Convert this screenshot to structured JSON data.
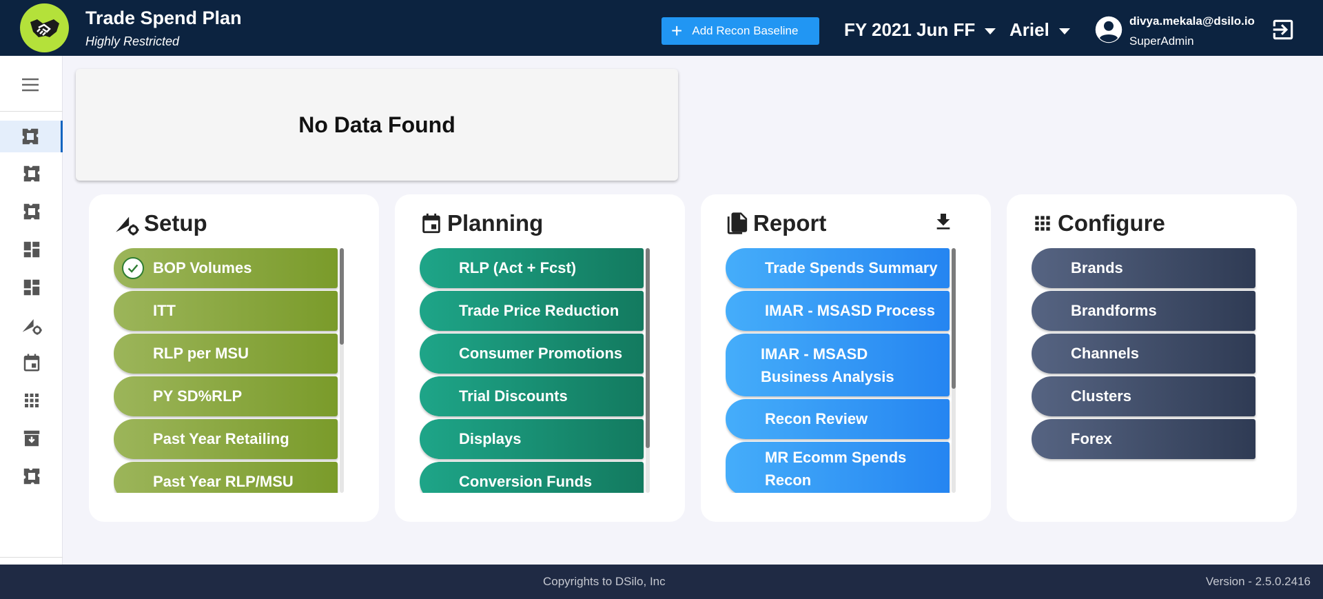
{
  "header": {
    "title": "Trade Spend Plan",
    "subtitle": "Highly Restricted",
    "add_button_label": "Add Recon Baseline",
    "period_selector": "FY 2021 Jun FF",
    "brand_selector": "Ariel",
    "user_email": "divya.mekala@dsilo.io",
    "user_role": "SuperAdmin"
  },
  "sidebar": {
    "icons": [
      "puzzle-icon",
      "puzzle-icon",
      "puzzle-icon",
      "dashboard-icon",
      "dashboard-icon",
      "setup-icon",
      "calendar-icon",
      "grid-icon",
      "archive-icon",
      "puzzle-icon"
    ],
    "active_index": 0
  },
  "no_data": {
    "message": "No Data Found"
  },
  "setup": {
    "title": "Setup",
    "items": [
      "BOP Volumes",
      "ITT",
      "RLP per MSU",
      "PY SD%RLP",
      "Past Year Retailing",
      "Past Year RLP/MSU"
    ]
  },
  "planning": {
    "title": "Planning",
    "items": [
      "RLP (Act + Fcst)",
      "Trade Price Reduction",
      "Consumer Promotions",
      "Trial Discounts",
      "Displays",
      "Conversion Funds"
    ]
  },
  "report": {
    "title": "Report",
    "items": [
      "Trade Spends Summary",
      "IMAR - MSASD Process",
      "IMAR - MSASD Business Analysis",
      "Recon Review",
      "MR Ecomm Spends Recon"
    ]
  },
  "configure": {
    "title": "Configure",
    "items": [
      "Brands",
      "Brandforms",
      "Channels",
      "Clusters",
      "Forex"
    ]
  },
  "footer": {
    "copyright": "Copyrights to DSilo, Inc",
    "version": "Version - 2.5.0.2416"
  },
  "colors": {
    "header_bg": "#0c2340",
    "accent": "#2196f3",
    "setup": "#7a9b2a",
    "planning": "#137a5f",
    "report": "#2585f1",
    "configure": "#2f3b54"
  }
}
